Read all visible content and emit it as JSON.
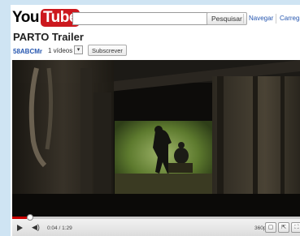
{
  "header": {
    "logo_you": "You",
    "logo_tube": "Tube",
    "search_value": "",
    "search_button": "Pesquisar",
    "nav": [
      "Navegar",
      "Carrega"
    ]
  },
  "video": {
    "title": "PARTO Trailer",
    "channel": "58ABCMr",
    "videos_count": "1 vídeos",
    "subscribe": "Subscrever"
  },
  "player": {
    "time": "0:04 / 1:29",
    "quality": "360p",
    "progress": 0.05,
    "icons": {
      "play": "play-icon",
      "volume": "volume-icon",
      "quality": "quality-arrow-icon",
      "popout": "popout-icon",
      "expand": "expand-icon",
      "fullscreen": "fullscreen-icon"
    }
  }
}
